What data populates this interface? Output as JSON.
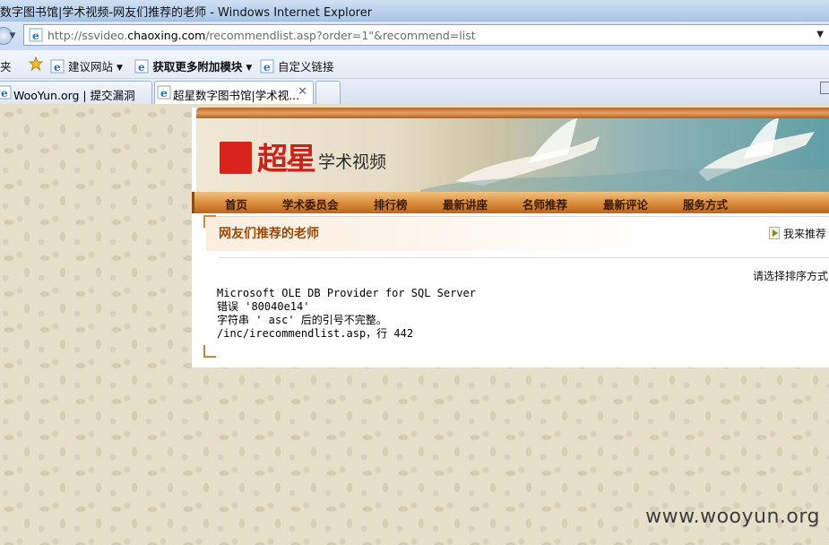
{
  "window": {
    "title": "数字图书馆|学术视频-网友们推荐的老师 - Windows Internet Explorer"
  },
  "address_bar": {
    "url_prefix": "http://ssvideo.",
    "url_domain": "chaoxing.com",
    "url_rest": "/recommendlist.asp?order=1\"&recommend=list"
  },
  "favorites_bar": {
    "favorites_label": "夹",
    "items": [
      {
        "label": "建议网站",
        "icon": "ie-page-icon"
      },
      {
        "label": "获取更多附加模块",
        "icon": "ie-page-icon"
      },
      {
        "label": "自定义链接",
        "icon": "ie-page-icon"
      }
    ]
  },
  "tabs": [
    {
      "label": "WooYun.org | 提交漏洞",
      "active": false
    },
    {
      "label": "超星数字图书馆|学术视...",
      "active": true
    }
  ],
  "site": {
    "logo_text": "超星",
    "logo_sub": "学术视频",
    "nav": [
      "首页",
      "学术委员会",
      "排行榜",
      "最新讲座",
      "名师推荐",
      "最新评论",
      "服务方式"
    ],
    "section_title": "网友们推荐的老师",
    "recommend_button": "我来推荐",
    "sort_label": "请选择排序方式",
    "error_lines": [
      "Microsoft OLE DB Provider for SQL Server",
      "错误 '80040e14'",
      "字符串 ' asc' 后的引号不完整。",
      "/inc/irecommendlist.asp，行 442"
    ]
  },
  "watermark": "www.wooyun.org",
  "colors": {
    "nav_bar": "#d98a3a",
    "section_title": "#9b4a0a",
    "logo_red": "#c8221a"
  }
}
